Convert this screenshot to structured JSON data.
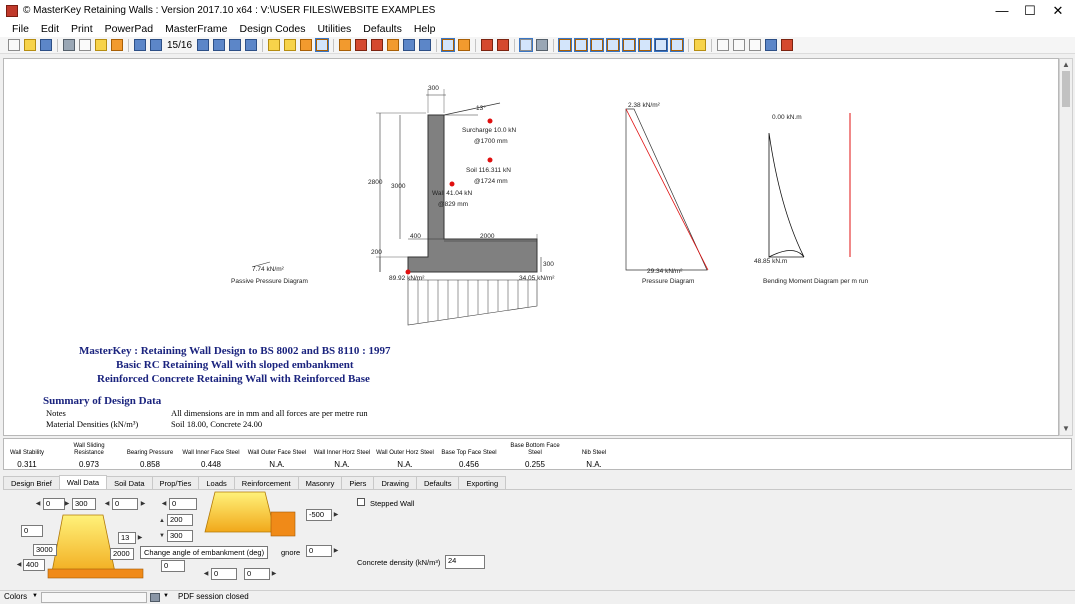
{
  "window": {
    "title": "© MasterKey Retaining Walls : Version 2017.10 x64 : V:\\USER FILES\\WEBSITE EXAMPLES",
    "minimize": "—",
    "maximize": "☐",
    "close": "✕"
  },
  "menu": [
    "File",
    "Edit",
    "Print",
    "PowerPad",
    "MasterFrame",
    "Design Codes",
    "Utilities",
    "Defaults",
    "Help"
  ],
  "toolbar": {
    "page_counter": "15/16"
  },
  "drawing": {
    "dims": {
      "stem_width": "300",
      "slope_angle": "13°",
      "retained_height": "2800",
      "stem_height": "3000",
      "base_thk_left": "200",
      "toe": "400",
      "heel": "2000",
      "base_thk_right": "300"
    },
    "forces": {
      "surcharge": "Surcharge 10.0 kN",
      "surcharge_at": "@1700 mm",
      "soil": "Soil 116.311 kN",
      "soil_at": "@1724 mm",
      "wall": "Wall 41.04 kN",
      "wall_at": "@829 mm"
    },
    "bearing_left": "89.92 kN/m²",
    "bearing_right": "34.05 kN/m²",
    "passive": {
      "value": "7.74 kN/m²",
      "caption": "Passive Pressure Diagram"
    },
    "pressure": {
      "top": "2.38 kN/m²",
      "bottom": "29.34 kN/m²",
      "caption": "Pressure Diagram"
    },
    "moment": {
      "top": "0.00 kN.m",
      "bottom": "48.85 kN.m",
      "caption": "Bending Moment Diagram per m run"
    }
  },
  "report": {
    "title1": "MasterKey : Retaining Wall Design to BS 8002 and BS 8110 : 1997",
    "title2": "Basic RC Retaining Wall with sloped embankment",
    "title3": "Reinforced Concrete Retaining Wall with Reinforced  Base",
    "summary": "Summary of Design Data",
    "rows": [
      {
        "label": "Notes",
        "value": "All dimensions are in mm and all forces are per metre run"
      },
      {
        "label": "Material Densities (kN/m³)",
        "value": "Soil 18.00, Concrete 24.00"
      }
    ]
  },
  "results": [
    {
      "label": "Wall Stability",
      "value": "0.311"
    },
    {
      "label": "Wall Sliding Resistance",
      "value": "0.973"
    },
    {
      "label": "Bearing Pressure",
      "value": "0.858"
    },
    {
      "label": "Wall Inner Face Steel",
      "value": "0.448"
    },
    {
      "label": "Wall Outer Face Steel",
      "value": "N.A."
    },
    {
      "label": "Wall Inner Horz Steel",
      "value": "N.A."
    },
    {
      "label": "Wall Outer Horz Steel",
      "value": "N.A."
    },
    {
      "label": "Base Top Face Steel",
      "value": "0.456"
    },
    {
      "label": "Base Bottom Face Steel",
      "value": "0.255"
    },
    {
      "label": "Nib Steel",
      "value": "N.A."
    }
  ],
  "tabs": [
    "Design Brief",
    "Wall Data",
    "Soil Data",
    "Prop/Ties",
    "Loads",
    "Reinforcement",
    "Masonry",
    "Piers",
    "Drawing",
    "Defaults",
    "Exporting"
  ],
  "active_tab": "Wall Data",
  "wall_data": {
    "inputs": {
      "i1": "0",
      "i2": "300",
      "i3": "0",
      "i4": "0",
      "i5": "0",
      "i6": "13",
      "i7": "3000",
      "i8": "2000",
      "i9": "400",
      "i10": "200",
      "i11": "300",
      "i12": "-500",
      "i13": "0",
      "i14": "0",
      "i15": "0",
      "i16": "0"
    },
    "tooltip": "Change angle of embankment (deg)",
    "ignore_label": "gnore",
    "stepped_wall": "Stepped Wall",
    "concrete_density_label": "Concrete density (kN/m³)",
    "concrete_density": "24"
  },
  "status": {
    "colors": "Colors",
    "message": "PDF session closed"
  }
}
